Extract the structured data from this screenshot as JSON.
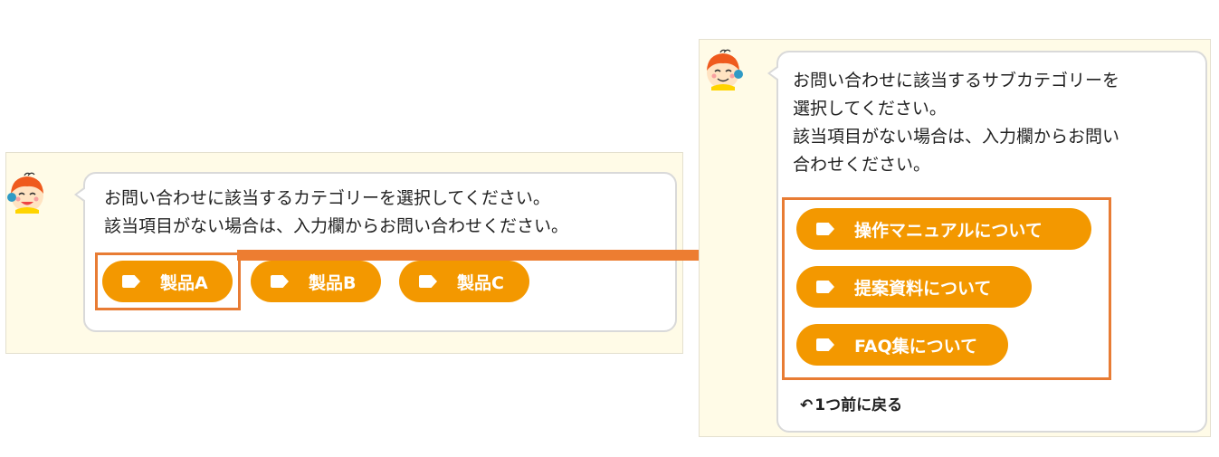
{
  "colors": {
    "chip_bg": "#f39800",
    "highlight": "#e87c34",
    "panel_bg": "#fffbe7",
    "arrow": "#ed7d31"
  },
  "left": {
    "message_lines": [
      "お問い合わせに該当するカテゴリーを選択してください。",
      "該当項目がない場合は、入力欄からお問い合わせください。"
    ],
    "chips": [
      "製品A",
      "製品B",
      "製品C"
    ]
  },
  "right": {
    "message_lines": [
      "お問い合わせに該当するサブカテゴリーを",
      "選択してください。",
      "該当項目がない場合は、入力欄からお問い",
      "合わせください。"
    ],
    "chips": [
      "操作マニュアルについて",
      "提案資料について",
      "FAQ集について"
    ],
    "back_label": "1つ前に戻る"
  },
  "icons": {
    "avatar": "chatbot-avatar-icon",
    "chip": "tag-icon",
    "back": "undo-icon"
  }
}
